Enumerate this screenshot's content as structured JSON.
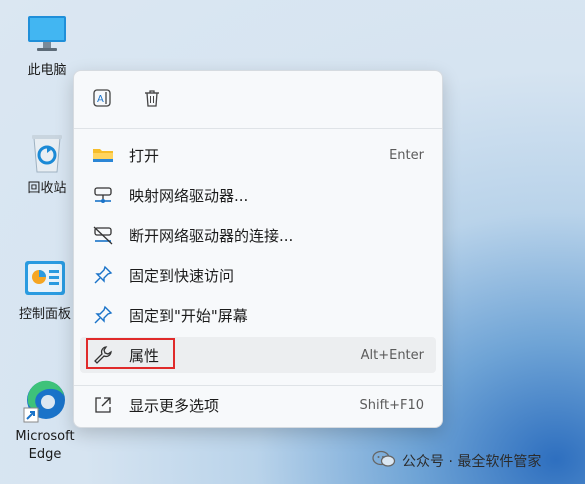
{
  "desktop": {
    "icons": [
      {
        "name": "此电脑"
      },
      {
        "name": "回收站"
      },
      {
        "name": "控制面板"
      },
      {
        "name": "Microsoft Edge"
      }
    ]
  },
  "context_menu": {
    "top_actions": [
      "rename-icon",
      "delete-icon"
    ],
    "items": [
      {
        "label": "打开",
        "shortcut": "Enter",
        "icon": "folder-icon"
      },
      {
        "label": "映射网络驱动器...",
        "shortcut": "",
        "icon": "network-drive-icon"
      },
      {
        "label": "断开网络驱动器的连接...",
        "shortcut": "",
        "icon": "disconnect-drive-icon"
      },
      {
        "label": "固定到快速访问",
        "shortcut": "",
        "icon": "pin-icon"
      },
      {
        "label": "固定到\"开始\"屏幕",
        "shortcut": "",
        "icon": "pin-icon"
      },
      {
        "label": "属性",
        "shortcut": "Alt+Enter",
        "icon": "wrench-icon",
        "hovered": true,
        "highlighted": true
      },
      {
        "label": "显示更多选项",
        "shortcut": "Shift+F10",
        "icon": "share-expand-icon"
      }
    ]
  },
  "watermark": {
    "text": "公众号 · 最全软件管家"
  },
  "colors": {
    "highlight_border": "#e02a2a",
    "menu_bg": "#f7f9fb",
    "accent": "#1a73c9"
  }
}
